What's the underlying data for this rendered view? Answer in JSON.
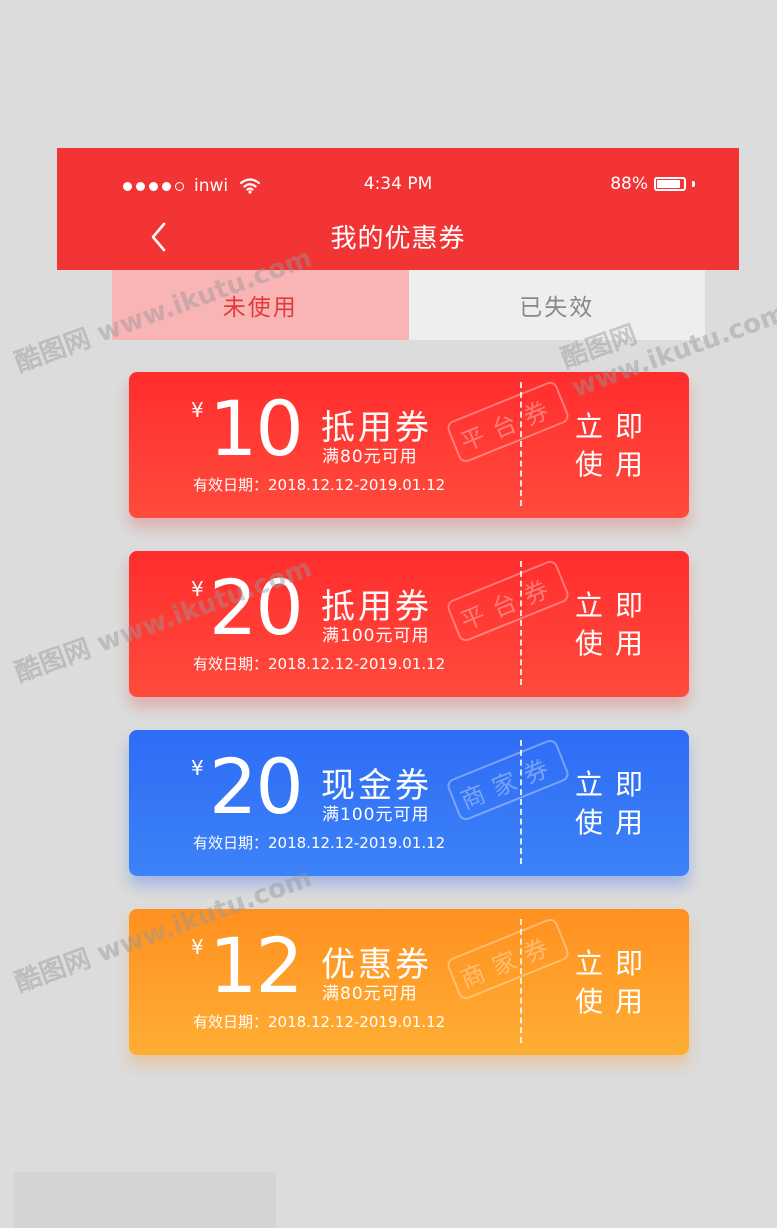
{
  "status_bar": {
    "carrier": "inwi",
    "time": "4:34 PM",
    "battery_percent": "88%",
    "battery_level": 0.88
  },
  "nav": {
    "title": "我的优惠券",
    "back_icon": "chevron-left-icon"
  },
  "tabs": [
    {
      "label": "未使用",
      "active": true
    },
    {
      "label": "已失效",
      "active": false
    }
  ],
  "coupons": [
    {
      "currency": "¥",
      "amount": "10",
      "type": "抵用券",
      "condition": "满80元可用",
      "validity": "有效日期：2018.12.12-2019.01.12",
      "stamp": "平台券",
      "action_line1": "立即",
      "action_line2": "使用",
      "color": "#ff3333"
    },
    {
      "currency": "¥",
      "amount": "20",
      "type": "抵用券",
      "condition": "满100元可用",
      "validity": "有效日期：2018.12.12-2019.01.12",
      "stamp": "平台券",
      "action_line1": "立即",
      "action_line2": "使用",
      "color": "#ff3333"
    },
    {
      "currency": "¥",
      "amount": "20",
      "type": "现金券",
      "condition": "满100元可用",
      "validity": "有效日期：2018.12.12-2019.01.12",
      "stamp": "商家券",
      "action_line1": "立即",
      "action_line2": "使用",
      "color": "#3377f6"
    },
    {
      "currency": "¥",
      "amount": "12",
      "type": "优惠券",
      "condition": "满80元可用",
      "validity": "有效日期：2018.12.12-2019.01.12",
      "stamp": "商家券",
      "action_line1": "立即",
      "action_line2": "使用",
      "color": "#ffa02a"
    }
  ],
  "watermark": "酷图网 www.ikutu.com"
}
